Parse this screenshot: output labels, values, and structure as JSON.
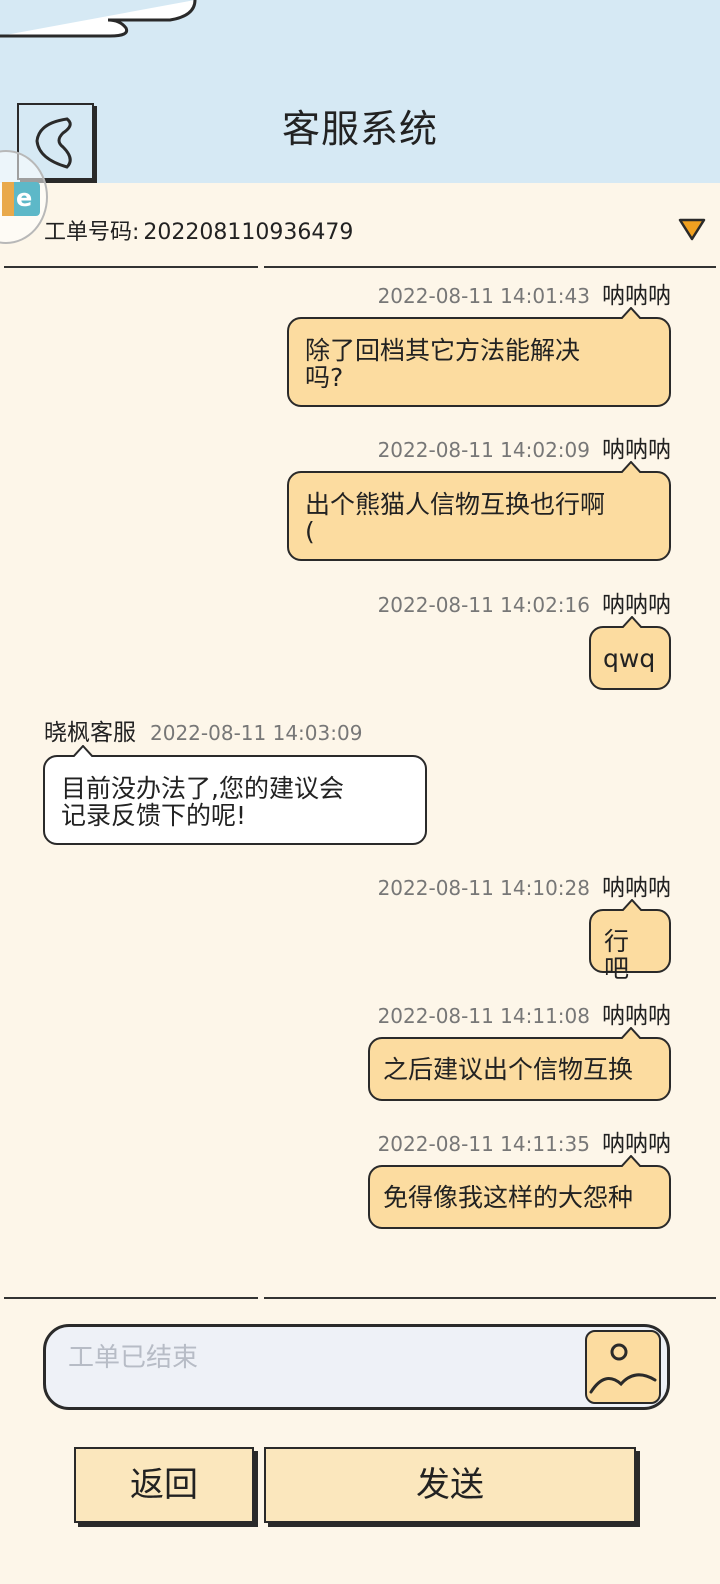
{
  "header": {
    "title": "客服系统"
  },
  "ticket": {
    "label": "工单号码:",
    "number": "202208110936479"
  },
  "messages": [
    {
      "side": "out",
      "name": "呐呐呐",
      "time": "2022-08-11 14:01:43",
      "lines": [
        "除了回档其它方法能解决",
        "吗?"
      ]
    },
    {
      "side": "out",
      "name": "呐呐呐",
      "time": "2022-08-11 14:02:09",
      "lines": [
        "出个熊猫人信物互换也行啊",
        " ("
      ]
    },
    {
      "side": "out",
      "name": "呐呐呐",
      "time": "2022-08-11 14:02:16",
      "lines": [
        "qwq"
      ]
    },
    {
      "side": "in",
      "name": "晓枫客服",
      "time": "2022-08-11 14:03:09",
      "lines": [
        "目前没办法了,您的建议会",
        "记录反馈下的呢!"
      ]
    },
    {
      "side": "out",
      "name": "呐呐呐",
      "time": "2022-08-11 14:10:28",
      "lines": [
        "行吧"
      ]
    },
    {
      "side": "out",
      "name": "呐呐呐",
      "time": "2022-08-11 14:11:08",
      "lines": [
        "之后建议出个信物互换"
      ]
    },
    {
      "side": "out",
      "name": "呐呐呐",
      "time": "2022-08-11 14:11:35",
      "lines": [
        "免得像我这样的大怨种"
      ]
    }
  ],
  "input": {
    "placeholder": "工单已结束"
  },
  "buttons": {
    "back": "返回",
    "send": "发送"
  },
  "colors": {
    "header_bg": "#d6e9f4",
    "page_bg": "#fdf6e9",
    "out_bubble": "#fcdca0",
    "in_bubble": "#ffffff",
    "dropdown": "#f0a020"
  },
  "icons": {
    "back": "chevron-left-icon",
    "dropdown": "triangle-down-icon",
    "image": "image-icon"
  }
}
